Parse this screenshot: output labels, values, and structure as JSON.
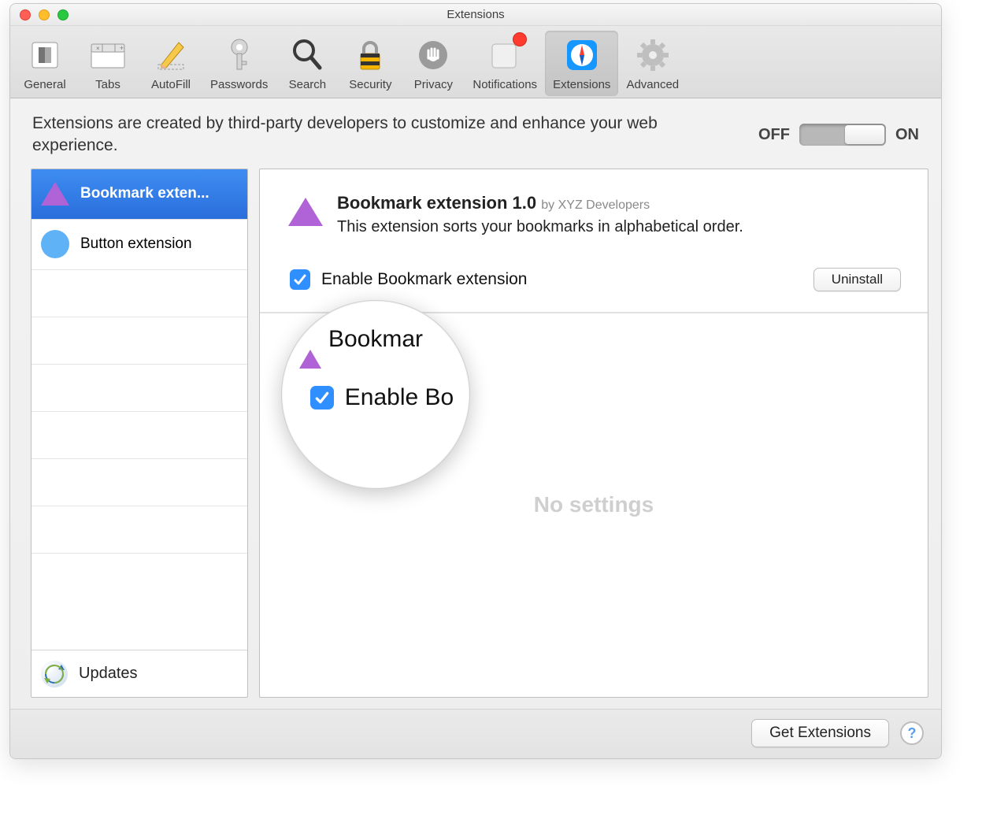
{
  "window": {
    "title": "Extensions"
  },
  "toolbar": {
    "items": [
      {
        "label": "General"
      },
      {
        "label": "Tabs"
      },
      {
        "label": "AutoFill"
      },
      {
        "label": "Passwords"
      },
      {
        "label": "Search"
      },
      {
        "label": "Security"
      },
      {
        "label": "Privacy"
      },
      {
        "label": "Notifications"
      },
      {
        "label": "Extensions"
      },
      {
        "label": "Advanced"
      }
    ]
  },
  "intro": "Extensions are created by third-party developers to customize and enhance your web experience.",
  "toggle": {
    "off": "OFF",
    "on": "ON",
    "state": "on"
  },
  "sidebar": {
    "items": [
      {
        "label": "Bookmark exten...",
        "selected": true
      },
      {
        "label": "Button extension",
        "selected": false
      }
    ],
    "updates": "Updates"
  },
  "detail": {
    "title": "Bookmark extension 1.0",
    "by_prefix": "by",
    "developer": "XYZ Developers",
    "description": "This extension sorts your bookmarks in alphabetical order.",
    "enable_label": "Enable Bookmark extension",
    "uninstall": "Uninstall",
    "no_settings": "No settings"
  },
  "footer": {
    "get_extensions": "Get Extensions",
    "help": "?"
  },
  "magnifier": {
    "top_text": "Bookmar",
    "label": "Enable Bo"
  }
}
